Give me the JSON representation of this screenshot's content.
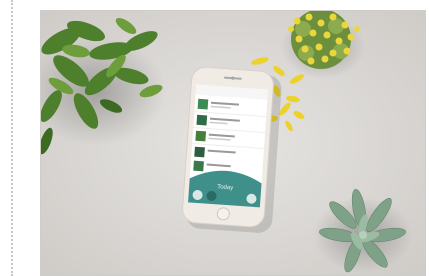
{
  "scene": {
    "description_items": {
      "phone_label": "Today",
      "plants": [
        "leafy-plant",
        "yellow-flower-pot",
        "succulent-pot"
      ],
      "petals": "yellow-petals"
    }
  },
  "colors": {
    "background_surface": "#dedcd9",
    "phone_body": "#f3ece6",
    "phone_screen": "#ffffff",
    "teal_accent": "#3f8f8a",
    "leaf_green": "#4b7a2e",
    "succulent_green": "#7c9e86",
    "flower_yellow": "#e9d23a"
  }
}
